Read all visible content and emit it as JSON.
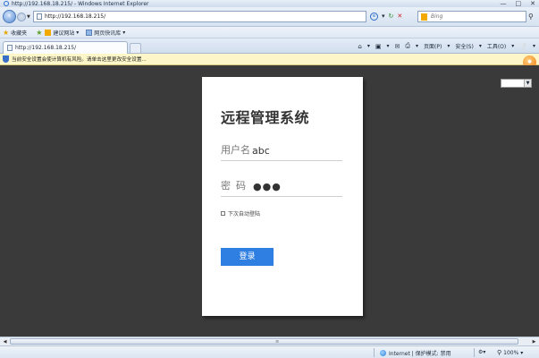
{
  "window": {
    "title": "http://192.168.18.215/ - Windows Internet Explorer",
    "controls": [
      "—",
      "□",
      "✕"
    ]
  },
  "address_bar": {
    "url": "http://192.168.18.215/",
    "search_placeholder": "Bing"
  },
  "favorites_bar": {
    "favorites_label": "收藏夹",
    "items": [
      "建议网站",
      "网页快讯库"
    ]
  },
  "tab": {
    "title": "http://192.168.18.215/"
  },
  "command_bar": {
    "page_label": "页面(P)",
    "safety_label": "安全(S)",
    "tools_label": "工具(O)"
  },
  "info_bar": {
    "message": "当前安全设置会使计算机有风险。请单击这里更改安全设置..."
  },
  "login": {
    "title": "远程管理系统",
    "username_label": "用户名",
    "username_value": "abc",
    "password_label": "密码",
    "password_value": "●●●",
    "remember_label": "下次自动登陆",
    "login_button": "登录"
  },
  "status_bar": {
    "zone": "Internet | 保护模式: 禁用",
    "zoom": "100%"
  },
  "colors": {
    "content_bg": "#3a3a3a",
    "login_button": "#2f7fe3",
    "info_bar": "#fdf6c8"
  }
}
